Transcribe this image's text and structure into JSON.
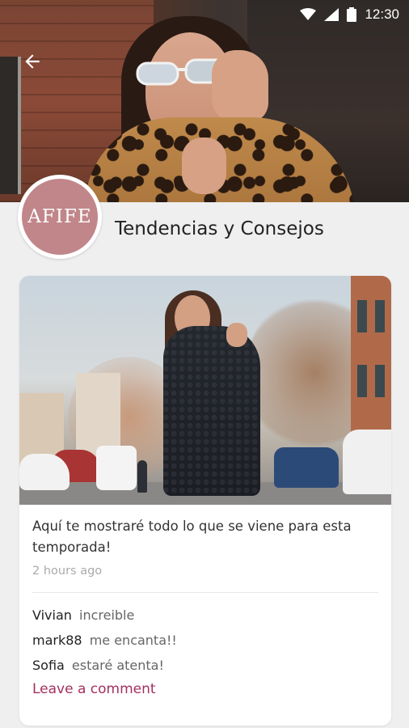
{
  "status_bar": {
    "time": "12:30",
    "icons": [
      "wifi-icon",
      "signal-icon",
      "battery-icon"
    ]
  },
  "header": {
    "back_icon": "arrow-left-icon",
    "logo_text": "AFIFE",
    "title": "Tendencias y Consejos"
  },
  "post": {
    "text": "Aquí te mostraré todo lo que se viene para esta temporada!",
    "time": "2 hours ago",
    "comments": [
      {
        "author": "Vivian",
        "text": "increible"
      },
      {
        "author": "mark88",
        "text": "me encanta!!"
      },
      {
        "author": "Sofia",
        "text": "estaré atenta!"
      }
    ],
    "leave_comment_label": "Leave a comment"
  },
  "colors": {
    "background": "#efeff0",
    "logo": "#c1868a",
    "accent": "#a3305f"
  }
}
